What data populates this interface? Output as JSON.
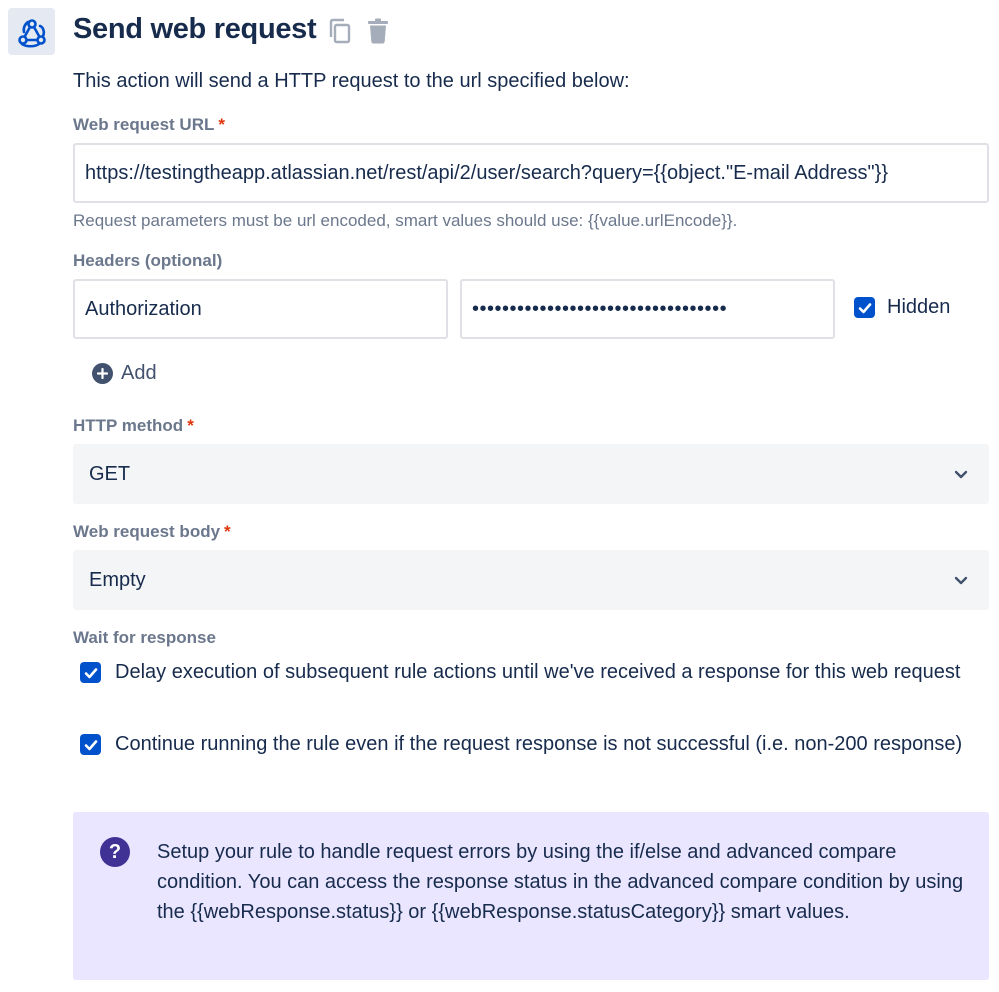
{
  "header": {
    "title": "Send web request",
    "icons": {
      "app": "webhook-icon",
      "copy": "copy-icon",
      "delete": "trash-icon"
    }
  },
  "description": "This action will send a HTTP request to the url specified below:",
  "url_field": {
    "label": "Web request URL",
    "required_mark": "*",
    "value": "https://testingtheapp.atlassian.net/rest/api/2/user/search?query={{object.\"E-mail Address\"}}",
    "hint": "Request parameters must be url encoded, smart values should use: {{value.urlEncode}}."
  },
  "headers": {
    "label": "Headers (optional)",
    "key": "Authorization",
    "value_masked": "••••••••••••••••••••••••••••••••••",
    "hidden_label": "Hidden",
    "hidden_checked": true,
    "add_label": "Add"
  },
  "method": {
    "label": "HTTP method",
    "required_mark": "*",
    "selected": "GET"
  },
  "body": {
    "label": "Web request body",
    "required_mark": "*",
    "selected": "Empty"
  },
  "wait": {
    "label": "Wait for response",
    "options": [
      {
        "label": "Delay execution of subsequent rule actions until we've received a response for this web request",
        "checked": true
      },
      {
        "label": "Continue running the rule even if the request response is not successful (i.e. non-200 response)",
        "checked": true
      }
    ]
  },
  "info": {
    "icon_glyph": "?",
    "text": "Setup your rule to handle request errors by using the if/else and advanced compare condition. You can access the response status in the advanced compare condition by using the {{webResponse.status}} or {{webResponse.statusCategory}} smart values."
  },
  "colors": {
    "primary": "#0052cc",
    "text": "#172b4d",
    "subtle": "#6b778c",
    "required": "#de350b",
    "info_bg": "#eae6ff",
    "info_icon": "#403294"
  }
}
